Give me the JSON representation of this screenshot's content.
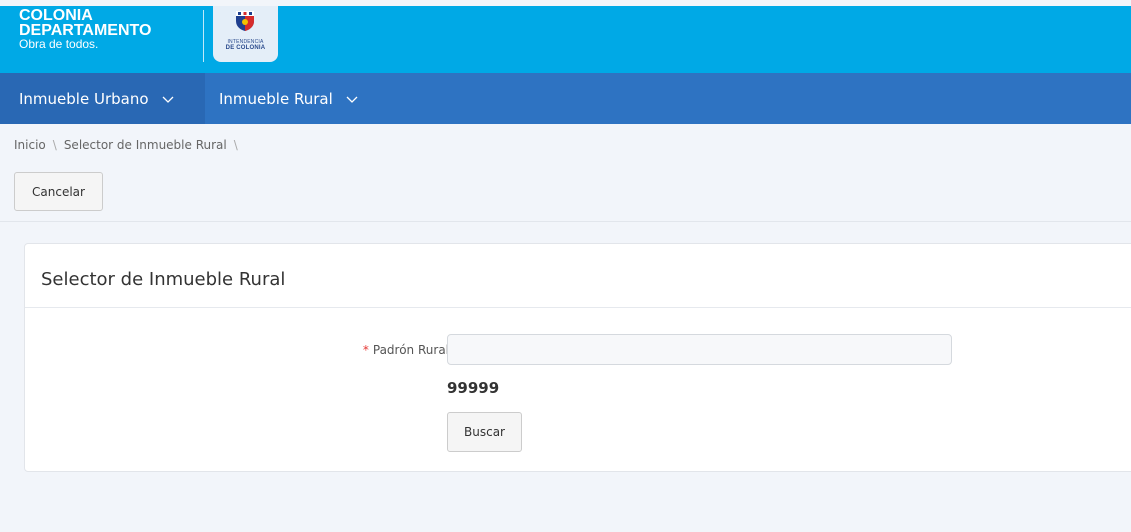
{
  "brand": {
    "line1": "COLONIA",
    "line2": "DEPARTAMENTO",
    "line3": "Obra de todos.",
    "badge_line1": "INTENDENCIA",
    "badge_line2": "DE COLONIA"
  },
  "nav": {
    "items": [
      {
        "label": "Inmueble Urbano",
        "icon": "chevron-down-icon"
      },
      {
        "label": "Inmueble Rural",
        "icon": "chevron-down-icon"
      }
    ]
  },
  "breadcrumb": {
    "items": [
      {
        "label": "Inicio"
      },
      {
        "label": "Selector de Inmueble Rural"
      }
    ],
    "separator": "\\"
  },
  "toolbar": {
    "cancel_label": "Cancelar"
  },
  "panel": {
    "title": "Selector de Inmueble Rural",
    "field": {
      "required_marker": "*",
      "label": "Padrón Rural",
      "value": "",
      "placeholder": "",
      "help_text": "99999"
    },
    "search_label": "Buscar"
  },
  "colors": {
    "header_bg": "#00a9e6",
    "navbar_bg": "#2e73c2",
    "required": "#e53935"
  }
}
